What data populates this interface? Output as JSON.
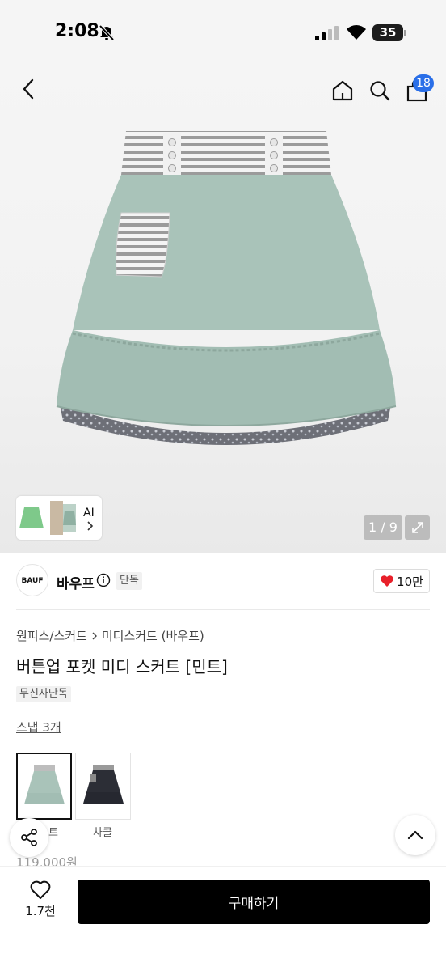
{
  "status_bar": {
    "time": "2:08",
    "battery": "35"
  },
  "header": {
    "cart_count": "18"
  },
  "gallery": {
    "page_indicator": "1 / 9",
    "ai_label": "AI"
  },
  "brand": {
    "logo_text": "BAUF",
    "name": "바우프",
    "badge": "단독",
    "like_count": "10만"
  },
  "breadcrumb": {
    "category": "원피스/스커트",
    "subcategory": "미디스커트 (바우프)"
  },
  "product": {
    "title": "버튼업 포켓 미디 스커트 [민트]",
    "exclusive_badge": "무신사단독",
    "snap_link": "스냅 3개",
    "original_price": "119,000원"
  },
  "color_options": [
    {
      "label": "트",
      "selected": true
    },
    {
      "label": "차콜",
      "selected": false
    }
  ],
  "bottom_bar": {
    "wish_count": "1.7천",
    "buy_label": "구매하기"
  },
  "colors": {
    "accent_blue": "#2a6fe8",
    "like_red": "#e8202a",
    "skirt_mint": "#a8c3b8",
    "black": "#000000"
  },
  "icons": [
    "bell-slash-icon",
    "signal-icon",
    "wifi-icon",
    "back-arrow-icon",
    "home-icon",
    "search-icon",
    "shopping-bag-icon",
    "info-icon",
    "heart-icon",
    "chevron-right-icon",
    "expand-icon",
    "share-icon",
    "chevron-up-icon"
  ]
}
